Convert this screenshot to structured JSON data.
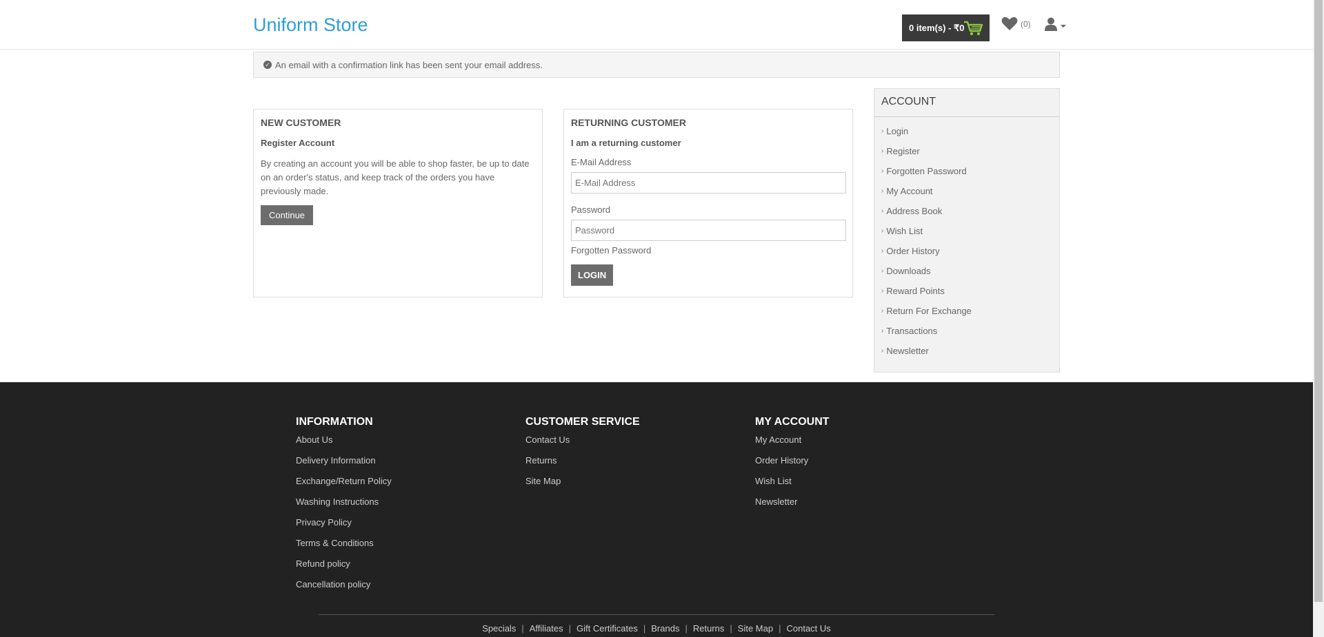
{
  "header": {
    "logo": "Uniform Store",
    "cart_label": "0 item(s) - ₹0",
    "wishlist_count": "(0)"
  },
  "alert": {
    "message": "An email with a confirmation link has been sent your email address."
  },
  "new_customer": {
    "title": "NEW CUSTOMER",
    "subtitle": "Register Account",
    "description": "By creating an account you will be able to shop faster, be up to date on an order's status, and keep track of the orders you have previously made.",
    "button": "Continue"
  },
  "returning_customer": {
    "title": "RETURNING CUSTOMER",
    "subtitle": "I am a returning customer",
    "email_label": "E-Mail Address",
    "email_placeholder": "E-Mail Address",
    "password_label": "Password",
    "password_placeholder": "Password",
    "forgot_link": "Forgotten Password",
    "button": "LOGIN"
  },
  "sidebar": {
    "title": "ACCOUNT",
    "items": [
      {
        "label": "Login"
      },
      {
        "label": "Register"
      },
      {
        "label": "Forgotten Password"
      },
      {
        "label": "My Account"
      },
      {
        "label": "Address Book"
      },
      {
        "label": "Wish List"
      },
      {
        "label": "Order History"
      },
      {
        "label": "Downloads"
      },
      {
        "label": "Reward Points"
      },
      {
        "label": "Return For Exchange"
      },
      {
        "label": "Transactions"
      },
      {
        "label": "Newsletter"
      }
    ]
  },
  "footer": {
    "information": {
      "title": "INFORMATION",
      "links": [
        "About Us",
        "Delivery Information",
        "Exchange/Return Policy",
        "Washing Instructions",
        "Privacy Policy",
        "Terms & Conditions",
        "Refund policy",
        "Cancellation policy"
      ]
    },
    "customer_service": {
      "title": "CUSTOMER SERVICE",
      "links": [
        "Contact Us",
        "Returns",
        "Site Map"
      ]
    },
    "my_account": {
      "title": "MY ACCOUNT",
      "links": [
        "My Account",
        "Order History",
        "Wish List",
        "Newsletter"
      ]
    },
    "bottom_links": [
      "Specials",
      "Affiliates",
      "Gift Certificates",
      "Brands",
      "Returns",
      "Site Map",
      "Contact Us"
    ]
  },
  "colors": {
    "logo": "#2e9fd6",
    "cart_bg": "#3a3a3a",
    "cart_icon": "#8cc63f",
    "button_bg": "#6c6c6c",
    "footer_bg": "#222222"
  }
}
